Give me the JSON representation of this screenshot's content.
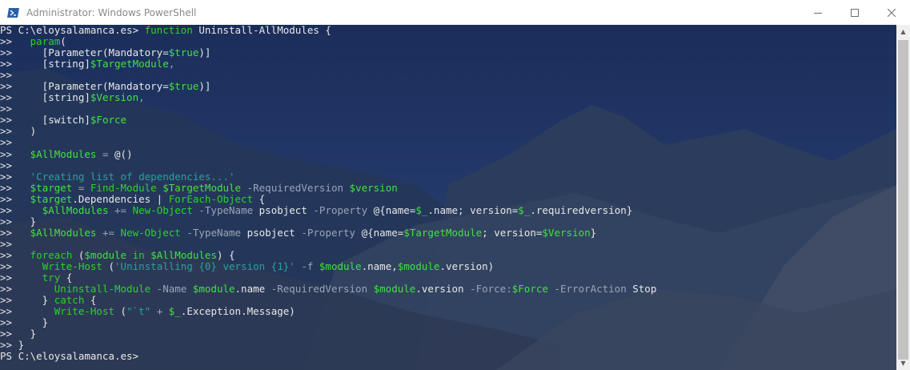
{
  "window": {
    "title": "Administrator: Windows PowerShell"
  },
  "icons": {
    "app": "powershell-icon",
    "minimize": "minimize-icon",
    "maximize": "maximize-icon",
    "close": "close-icon"
  },
  "colors": {
    "console_bg": "#1c2f5a",
    "keyword": "#2bd12b",
    "variable": "#43e043",
    "operator": "#9aa3b8",
    "string": "#2aa198",
    "text": "#e8e8e8"
  },
  "console": {
    "lines": [
      [
        [
          "txt",
          "PS C:\\eloysalamanca.es> "
        ],
        [
          "kw",
          "function"
        ],
        [
          "txt",
          " Uninstall-AllModules {"
        ]
      ],
      [
        [
          "txt",
          ">>   "
        ],
        [
          "kw",
          "param"
        ],
        [
          "txt",
          "("
        ]
      ],
      [
        [
          "txt",
          ">>     [Parameter(Mandatory="
        ],
        [
          "var",
          "$true"
        ],
        [
          "txt",
          ")]"
        ]
      ],
      [
        [
          "txt",
          ">>     [string]"
        ],
        [
          "var",
          "$TargetModule"
        ],
        [
          "op",
          ","
        ]
      ],
      [
        [
          "txt",
          ">>"
        ]
      ],
      [
        [
          "txt",
          ">>     [Parameter(Mandatory="
        ],
        [
          "var",
          "$true"
        ],
        [
          "txt",
          ")]"
        ]
      ],
      [
        [
          "txt",
          ">>     [string]"
        ],
        [
          "var",
          "$Version"
        ],
        [
          "op",
          ","
        ]
      ],
      [
        [
          "txt",
          ">>"
        ]
      ],
      [
        [
          "txt",
          ">>     [switch]"
        ],
        [
          "var",
          "$Force"
        ]
      ],
      [
        [
          "txt",
          ">>   )"
        ]
      ],
      [
        [
          "txt",
          ">>"
        ]
      ],
      [
        [
          "txt",
          ">>   "
        ],
        [
          "var",
          "$AllModules"
        ],
        [
          "op",
          " = "
        ],
        [
          "txt",
          "@()"
        ]
      ],
      [
        [
          "txt",
          ">>"
        ]
      ],
      [
        [
          "txt",
          ">>   "
        ],
        [
          "str",
          "'Creating list of dependencies...'"
        ]
      ],
      [
        [
          "txt",
          ">>   "
        ],
        [
          "var",
          "$target"
        ],
        [
          "op",
          " = "
        ],
        [
          "kw",
          "Find-Module"
        ],
        [
          "txt",
          " "
        ],
        [
          "var",
          "$TargetModule"
        ],
        [
          "op",
          " -RequiredVersion "
        ],
        [
          "var",
          "$version"
        ]
      ],
      [
        [
          "txt",
          ">>   "
        ],
        [
          "var",
          "$target"
        ],
        [
          "txt",
          ".Dependencies | "
        ],
        [
          "kw",
          "ForEach-Object"
        ],
        [
          "txt",
          " {"
        ]
      ],
      [
        [
          "txt",
          ">>     "
        ],
        [
          "var",
          "$AllModules"
        ],
        [
          "op",
          " += "
        ],
        [
          "kw",
          "New-Object"
        ],
        [
          "op",
          " -TypeName "
        ],
        [
          "txt",
          "psobject "
        ],
        [
          "op",
          "-Property "
        ],
        [
          "txt",
          "@{name="
        ],
        [
          "var",
          "$_"
        ],
        [
          "txt",
          ".name; version="
        ],
        [
          "var",
          "$_"
        ],
        [
          "txt",
          ".requiredversion}"
        ]
      ],
      [
        [
          "txt",
          ">>   }"
        ]
      ],
      [
        [
          "txt",
          ">>   "
        ],
        [
          "var",
          "$AllModules"
        ],
        [
          "op",
          " += "
        ],
        [
          "kw",
          "New-Object"
        ],
        [
          "op",
          " -TypeName "
        ],
        [
          "txt",
          "psobject "
        ],
        [
          "op",
          "-Property "
        ],
        [
          "txt",
          "@{name="
        ],
        [
          "var",
          "$TargetModule"
        ],
        [
          "txt",
          "; version="
        ],
        [
          "var",
          "$Version"
        ],
        [
          "txt",
          "}"
        ]
      ],
      [
        [
          "txt",
          ">>"
        ]
      ],
      [
        [
          "txt",
          ">>   "
        ],
        [
          "kw",
          "foreach"
        ],
        [
          "txt",
          " ("
        ],
        [
          "var",
          "$module"
        ],
        [
          "txt",
          " "
        ],
        [
          "kw",
          "in"
        ],
        [
          "txt",
          " "
        ],
        [
          "var",
          "$AllModules"
        ],
        [
          "txt",
          ") {"
        ]
      ],
      [
        [
          "txt",
          ">>     "
        ],
        [
          "kw",
          "Write-Host"
        ],
        [
          "txt",
          " ("
        ],
        [
          "str",
          "'Uninstalling {0} version {1}'"
        ],
        [
          "op",
          " -f "
        ],
        [
          "var",
          "$module"
        ],
        [
          "txt",
          ".name,"
        ],
        [
          "var",
          "$module"
        ],
        [
          "txt",
          ".version)"
        ]
      ],
      [
        [
          "txt",
          ">>     "
        ],
        [
          "kw",
          "try"
        ],
        [
          "txt",
          " {"
        ]
      ],
      [
        [
          "txt",
          ">>       "
        ],
        [
          "kw",
          "Uninstall-Module"
        ],
        [
          "op",
          " -Name "
        ],
        [
          "var",
          "$module"
        ],
        [
          "txt",
          ".name "
        ],
        [
          "op",
          "-RequiredVersion "
        ],
        [
          "var",
          "$module"
        ],
        [
          "txt",
          ".version "
        ],
        [
          "op",
          "-Force:"
        ],
        [
          "var",
          "$Force"
        ],
        [
          "op",
          " -ErrorAction "
        ],
        [
          "txt",
          "Stop"
        ]
      ],
      [
        [
          "txt",
          ">>     } "
        ],
        [
          "kw",
          "catch"
        ],
        [
          "txt",
          " {"
        ]
      ],
      [
        [
          "txt",
          ">>       "
        ],
        [
          "kw",
          "Write-Host"
        ],
        [
          "txt",
          " ("
        ],
        [
          "str",
          "\"`t\""
        ],
        [
          "op",
          " + "
        ],
        [
          "var",
          "$_"
        ],
        [
          "txt",
          ".Exception.Message)"
        ]
      ],
      [
        [
          "txt",
          ">>     }"
        ]
      ],
      [
        [
          "txt",
          ">>   }"
        ]
      ],
      [
        [
          "txt",
          ">> }"
        ]
      ],
      [
        [
          "txt",
          "PS C:\\eloysalamanca.es>"
        ]
      ]
    ]
  }
}
